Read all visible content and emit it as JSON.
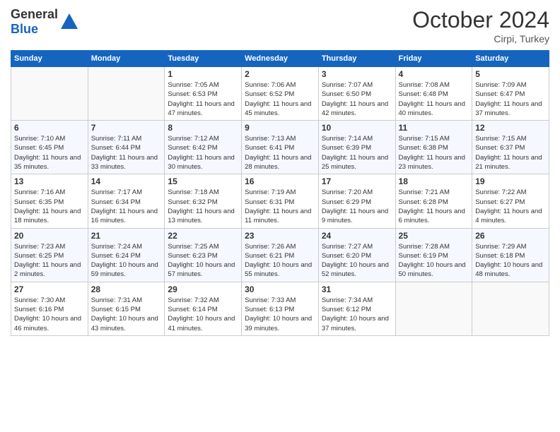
{
  "header": {
    "logo_general": "General",
    "logo_blue": "Blue",
    "month": "October 2024",
    "location": "Cirpi, Turkey"
  },
  "days_of_week": [
    "Sunday",
    "Monday",
    "Tuesday",
    "Wednesday",
    "Thursday",
    "Friday",
    "Saturday"
  ],
  "weeks": [
    [
      {
        "day": "",
        "sunrise": "",
        "sunset": "",
        "daylight": ""
      },
      {
        "day": "",
        "sunrise": "",
        "sunset": "",
        "daylight": ""
      },
      {
        "day": "1",
        "sunrise": "Sunrise: 7:05 AM",
        "sunset": "Sunset: 6:53 PM",
        "daylight": "Daylight: 11 hours and 47 minutes."
      },
      {
        "day": "2",
        "sunrise": "Sunrise: 7:06 AM",
        "sunset": "Sunset: 6:52 PM",
        "daylight": "Daylight: 11 hours and 45 minutes."
      },
      {
        "day": "3",
        "sunrise": "Sunrise: 7:07 AM",
        "sunset": "Sunset: 6:50 PM",
        "daylight": "Daylight: 11 hours and 42 minutes."
      },
      {
        "day": "4",
        "sunrise": "Sunrise: 7:08 AM",
        "sunset": "Sunset: 6:48 PM",
        "daylight": "Daylight: 11 hours and 40 minutes."
      },
      {
        "day": "5",
        "sunrise": "Sunrise: 7:09 AM",
        "sunset": "Sunset: 6:47 PM",
        "daylight": "Daylight: 11 hours and 37 minutes."
      }
    ],
    [
      {
        "day": "6",
        "sunrise": "Sunrise: 7:10 AM",
        "sunset": "Sunset: 6:45 PM",
        "daylight": "Daylight: 11 hours and 35 minutes."
      },
      {
        "day": "7",
        "sunrise": "Sunrise: 7:11 AM",
        "sunset": "Sunset: 6:44 PM",
        "daylight": "Daylight: 11 hours and 33 minutes."
      },
      {
        "day": "8",
        "sunrise": "Sunrise: 7:12 AM",
        "sunset": "Sunset: 6:42 PM",
        "daylight": "Daylight: 11 hours and 30 minutes."
      },
      {
        "day": "9",
        "sunrise": "Sunrise: 7:13 AM",
        "sunset": "Sunset: 6:41 PM",
        "daylight": "Daylight: 11 hours and 28 minutes."
      },
      {
        "day": "10",
        "sunrise": "Sunrise: 7:14 AM",
        "sunset": "Sunset: 6:39 PM",
        "daylight": "Daylight: 11 hours and 25 minutes."
      },
      {
        "day": "11",
        "sunrise": "Sunrise: 7:15 AM",
        "sunset": "Sunset: 6:38 PM",
        "daylight": "Daylight: 11 hours and 23 minutes."
      },
      {
        "day": "12",
        "sunrise": "Sunrise: 7:15 AM",
        "sunset": "Sunset: 6:37 PM",
        "daylight": "Daylight: 11 hours and 21 minutes."
      }
    ],
    [
      {
        "day": "13",
        "sunrise": "Sunrise: 7:16 AM",
        "sunset": "Sunset: 6:35 PM",
        "daylight": "Daylight: 11 hours and 18 minutes."
      },
      {
        "day": "14",
        "sunrise": "Sunrise: 7:17 AM",
        "sunset": "Sunset: 6:34 PM",
        "daylight": "Daylight: 11 hours and 16 minutes."
      },
      {
        "day": "15",
        "sunrise": "Sunrise: 7:18 AM",
        "sunset": "Sunset: 6:32 PM",
        "daylight": "Daylight: 11 hours and 13 minutes."
      },
      {
        "day": "16",
        "sunrise": "Sunrise: 7:19 AM",
        "sunset": "Sunset: 6:31 PM",
        "daylight": "Daylight: 11 hours and 11 minutes."
      },
      {
        "day": "17",
        "sunrise": "Sunrise: 7:20 AM",
        "sunset": "Sunset: 6:29 PM",
        "daylight": "Daylight: 11 hours and 9 minutes."
      },
      {
        "day": "18",
        "sunrise": "Sunrise: 7:21 AM",
        "sunset": "Sunset: 6:28 PM",
        "daylight": "Daylight: 11 hours and 6 minutes."
      },
      {
        "day": "19",
        "sunrise": "Sunrise: 7:22 AM",
        "sunset": "Sunset: 6:27 PM",
        "daylight": "Daylight: 11 hours and 4 minutes."
      }
    ],
    [
      {
        "day": "20",
        "sunrise": "Sunrise: 7:23 AM",
        "sunset": "Sunset: 6:25 PM",
        "daylight": "Daylight: 11 hours and 2 minutes."
      },
      {
        "day": "21",
        "sunrise": "Sunrise: 7:24 AM",
        "sunset": "Sunset: 6:24 PM",
        "daylight": "Daylight: 10 hours and 59 minutes."
      },
      {
        "day": "22",
        "sunrise": "Sunrise: 7:25 AM",
        "sunset": "Sunset: 6:23 PM",
        "daylight": "Daylight: 10 hours and 57 minutes."
      },
      {
        "day": "23",
        "sunrise": "Sunrise: 7:26 AM",
        "sunset": "Sunset: 6:21 PM",
        "daylight": "Daylight: 10 hours and 55 minutes."
      },
      {
        "day": "24",
        "sunrise": "Sunrise: 7:27 AM",
        "sunset": "Sunset: 6:20 PM",
        "daylight": "Daylight: 10 hours and 52 minutes."
      },
      {
        "day": "25",
        "sunrise": "Sunrise: 7:28 AM",
        "sunset": "Sunset: 6:19 PM",
        "daylight": "Daylight: 10 hours and 50 minutes."
      },
      {
        "day": "26",
        "sunrise": "Sunrise: 7:29 AM",
        "sunset": "Sunset: 6:18 PM",
        "daylight": "Daylight: 10 hours and 48 minutes."
      }
    ],
    [
      {
        "day": "27",
        "sunrise": "Sunrise: 7:30 AM",
        "sunset": "Sunset: 6:16 PM",
        "daylight": "Daylight: 10 hours and 46 minutes."
      },
      {
        "day": "28",
        "sunrise": "Sunrise: 7:31 AM",
        "sunset": "Sunset: 6:15 PM",
        "daylight": "Daylight: 10 hours and 43 minutes."
      },
      {
        "day": "29",
        "sunrise": "Sunrise: 7:32 AM",
        "sunset": "Sunset: 6:14 PM",
        "daylight": "Daylight: 10 hours and 41 minutes."
      },
      {
        "day": "30",
        "sunrise": "Sunrise: 7:33 AM",
        "sunset": "Sunset: 6:13 PM",
        "daylight": "Daylight: 10 hours and 39 minutes."
      },
      {
        "day": "31",
        "sunrise": "Sunrise: 7:34 AM",
        "sunset": "Sunset: 6:12 PM",
        "daylight": "Daylight: 10 hours and 37 minutes."
      },
      {
        "day": "",
        "sunrise": "",
        "sunset": "",
        "daylight": ""
      },
      {
        "day": "",
        "sunrise": "",
        "sunset": "",
        "daylight": ""
      }
    ]
  ]
}
